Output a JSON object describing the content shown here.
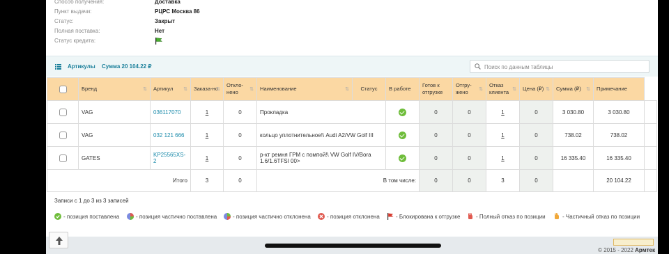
{
  "info": [
    {
      "label": "Способ получения:",
      "value": "Доставка"
    },
    {
      "label": "Пункт выдачи:",
      "value": "РЦРС Москва 86"
    },
    {
      "label": "Статус:",
      "value": "Закрыт"
    },
    {
      "label": "Полная поставка:",
      "value": "Нет"
    },
    {
      "label": "Статус кредита:",
      "value": "",
      "icon": "green-flag-icon"
    }
  ],
  "toolbar": {
    "articles_label": "Артикулы",
    "sum_label": "Сумма 20 104.22 ₽",
    "search_placeholder": "Поиск по данным таблицы"
  },
  "columns": [
    "Бренд",
    "Артикул",
    "Заказа-но",
    "Откло-нено",
    "Наименование",
    "Статус",
    "В работе",
    "Готов к отгрузке",
    "Отгру-жено",
    "Отказ клиента",
    "Цена (₽)",
    "Сумма (₽)",
    "Примечание"
  ],
  "rows": [
    {
      "brand": "VAG",
      "article": "036117070",
      "ordered": "1",
      "rejected": "0",
      "name": "Прокладка",
      "status_icon": "check-icon",
      "in_work": "0",
      "ready": "0",
      "shipped": "1",
      "client_refusal": "0",
      "price": "3 030.80",
      "sum": "3 030.80",
      "note": ""
    },
    {
      "brand": "VAG",
      "article": "032 121 666",
      "ordered": "1",
      "rejected": "0",
      "name": "кольцо уплотнительное!\\ Audi A2/VW Golf III",
      "status_icon": "check-icon",
      "in_work": "0",
      "ready": "0",
      "shipped": "1",
      "client_refusal": "0",
      "price": "738.02",
      "sum": "738.02",
      "note": ""
    },
    {
      "brand": "GATES",
      "article": "KP25565XS-2",
      "ordered": "1",
      "rejected": "0",
      "name": "р-кт ремня ГРМ с помпой!\\ VW Golf IV/Bora 1.6/1.6TFSI 00>",
      "status_icon": "check-icon",
      "in_work": "0",
      "ready": "0",
      "shipped": "1",
      "client_refusal": "0",
      "price": "16 335.40",
      "sum": "16 335.40",
      "note": ""
    }
  ],
  "totals": {
    "label": "Итого",
    "ordered": "3",
    "rejected": "0",
    "including_label": "В том числе:",
    "in_work": "0",
    "ready": "0",
    "shipped": "3",
    "client_refusal": "0",
    "sum": "20 104.22"
  },
  "records_text": "Записи с 1 до 3 из 3 записей",
  "legend": [
    {
      "icon": "check-icon",
      "text": "- позиция поставлена"
    },
    {
      "icon": "partial-delivery-icon",
      "text": "- позиция частично поставлена"
    },
    {
      "icon": "partial-reject-icon",
      "text": "- позиция частично отклонена"
    },
    {
      "icon": "reject-icon",
      "text": "- позиция отклонена"
    },
    {
      "icon": "blocked-flag-icon",
      "text": "- Блокирована к отгрузке"
    },
    {
      "icon": "full-refusal-hand-icon",
      "text": "- Полный отказ по позиции"
    },
    {
      "icon": "partial-refusal-hand-icon",
      "text": "- Частичный отказ по позиции"
    }
  ],
  "footer": {
    "copyright": "© 2015 - 2022",
    "brand": "Армтек"
  },
  "colors": {
    "header_bg": "#fbd8a3",
    "link": "#1a8aaa",
    "accent": "#1a7f9a",
    "ok_green": "#6fbd3b"
  }
}
